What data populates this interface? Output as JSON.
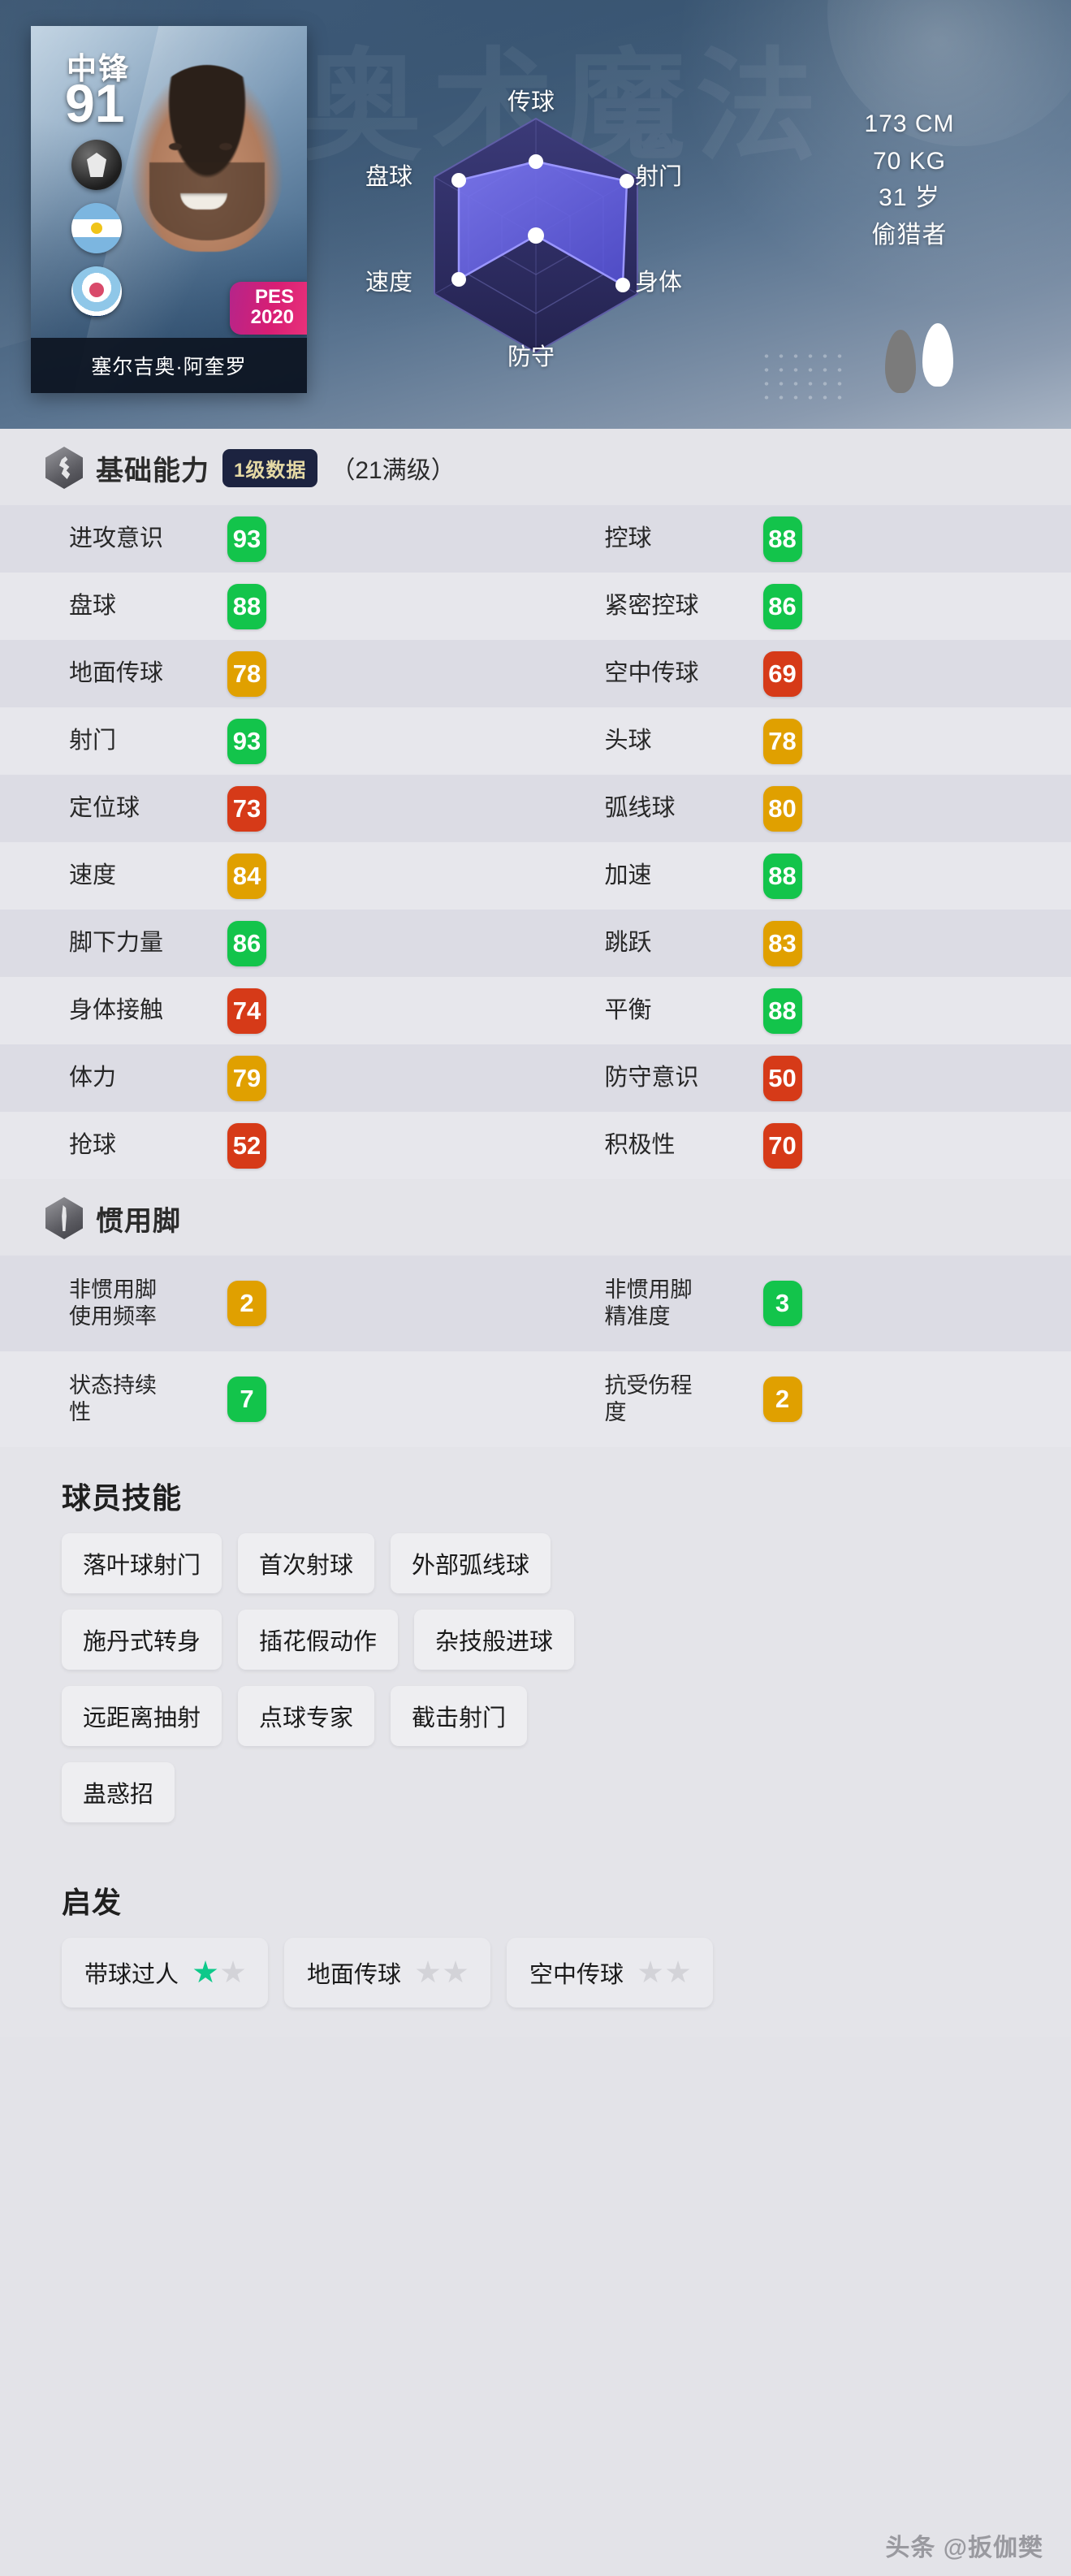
{
  "hero": {
    "ghost_text": "奥术魔法",
    "card": {
      "position": "中锋",
      "rating": "91",
      "name": "塞尔吉奥·阿奎罗",
      "game_tag_line1": "PES",
      "game_tag_line2": "2020",
      "badges": [
        "ball-badge",
        "argentina-flag-badge",
        "manchester-city-badge"
      ]
    },
    "radar": {
      "labels": {
        "top": "传球",
        "top_right": "射门",
        "bottom_right": "身体",
        "bottom": "防守",
        "bottom_left": "速度",
        "top_left": "盘球"
      }
    },
    "bio": {
      "height": "173 CM",
      "weight": "70 KG",
      "age": "31 岁",
      "playstyle": "偷猎者"
    }
  },
  "base_ability": {
    "title": "基础能力",
    "level_chip": "1级数据",
    "max_level": "（21满级）",
    "rows": [
      [
        {
          "label": "进攻意识",
          "value": "93",
          "color": "green"
        },
        {
          "label": "控球",
          "value": "88",
          "color": "green"
        }
      ],
      [
        {
          "label": "盘球",
          "value": "88",
          "color": "green"
        },
        {
          "label": "紧密控球",
          "value": "86",
          "color": "green"
        }
      ],
      [
        {
          "label": "地面传球",
          "value": "78",
          "color": "orange"
        },
        {
          "label": "空中传球",
          "value": "69",
          "color": "red"
        }
      ],
      [
        {
          "label": "射门",
          "value": "93",
          "color": "green"
        },
        {
          "label": "头球",
          "value": "78",
          "color": "orange"
        }
      ],
      [
        {
          "label": "定位球",
          "value": "73",
          "color": "red"
        },
        {
          "label": "弧线球",
          "value": "80",
          "color": "orange"
        }
      ],
      [
        {
          "label": "速度",
          "value": "84",
          "color": "orange"
        },
        {
          "label": "加速",
          "value": "88",
          "color": "green"
        }
      ],
      [
        {
          "label": "脚下力量",
          "value": "86",
          "color": "green"
        },
        {
          "label": "跳跃",
          "value": "83",
          "color": "orange"
        }
      ],
      [
        {
          "label": "身体接触",
          "value": "74",
          "color": "red"
        },
        {
          "label": "平衡",
          "value": "88",
          "color": "green"
        }
      ],
      [
        {
          "label": "体力",
          "value": "79",
          "color": "orange"
        },
        {
          "label": "防守意识",
          "value": "50",
          "color": "red"
        }
      ],
      [
        {
          "label": "抢球",
          "value": "52",
          "color": "red"
        },
        {
          "label": "积极性",
          "value": "70",
          "color": "red"
        }
      ]
    ]
  },
  "preferred_foot": {
    "title": "惯用脚",
    "rows": [
      [
        {
          "label": "非惯用脚\n使用频率",
          "value": "2",
          "color": "orange"
        },
        {
          "label": "非惯用脚\n精准度",
          "value": "3",
          "color": "green"
        }
      ],
      [
        {
          "label": "状态持续\n性",
          "value": "7",
          "color": "green"
        },
        {
          "label": "抗受伤程\n度",
          "value": "2",
          "color": "orange"
        }
      ]
    ]
  },
  "player_skills": {
    "title": "球员技能",
    "rows": [
      [
        "落叶球射门",
        "首次射球",
        "外部弧线球"
      ],
      [
        "施丹式转身",
        "插花假动作",
        "杂技般进球"
      ],
      [
        "远距离抽射",
        "点球专家",
        "截击射门"
      ],
      [
        "蛊惑招"
      ]
    ]
  },
  "inspiration": {
    "title": "启发",
    "items": [
      {
        "label": "带球过人",
        "filled": 1,
        "total": 2
      },
      {
        "label": "地面传球",
        "filled": 0,
        "total": 2
      },
      {
        "label": "空中传球",
        "filled": 0,
        "total": 2
      }
    ]
  },
  "watermark": "头条 @扳伽樊",
  "colors": {
    "green": "#13c44b",
    "orange": "#e0a000",
    "red": "#d63a18",
    "star_on": "#0dc98a",
    "chip_bg": "#1c2340",
    "chip_text": "#e5d9a4"
  }
}
